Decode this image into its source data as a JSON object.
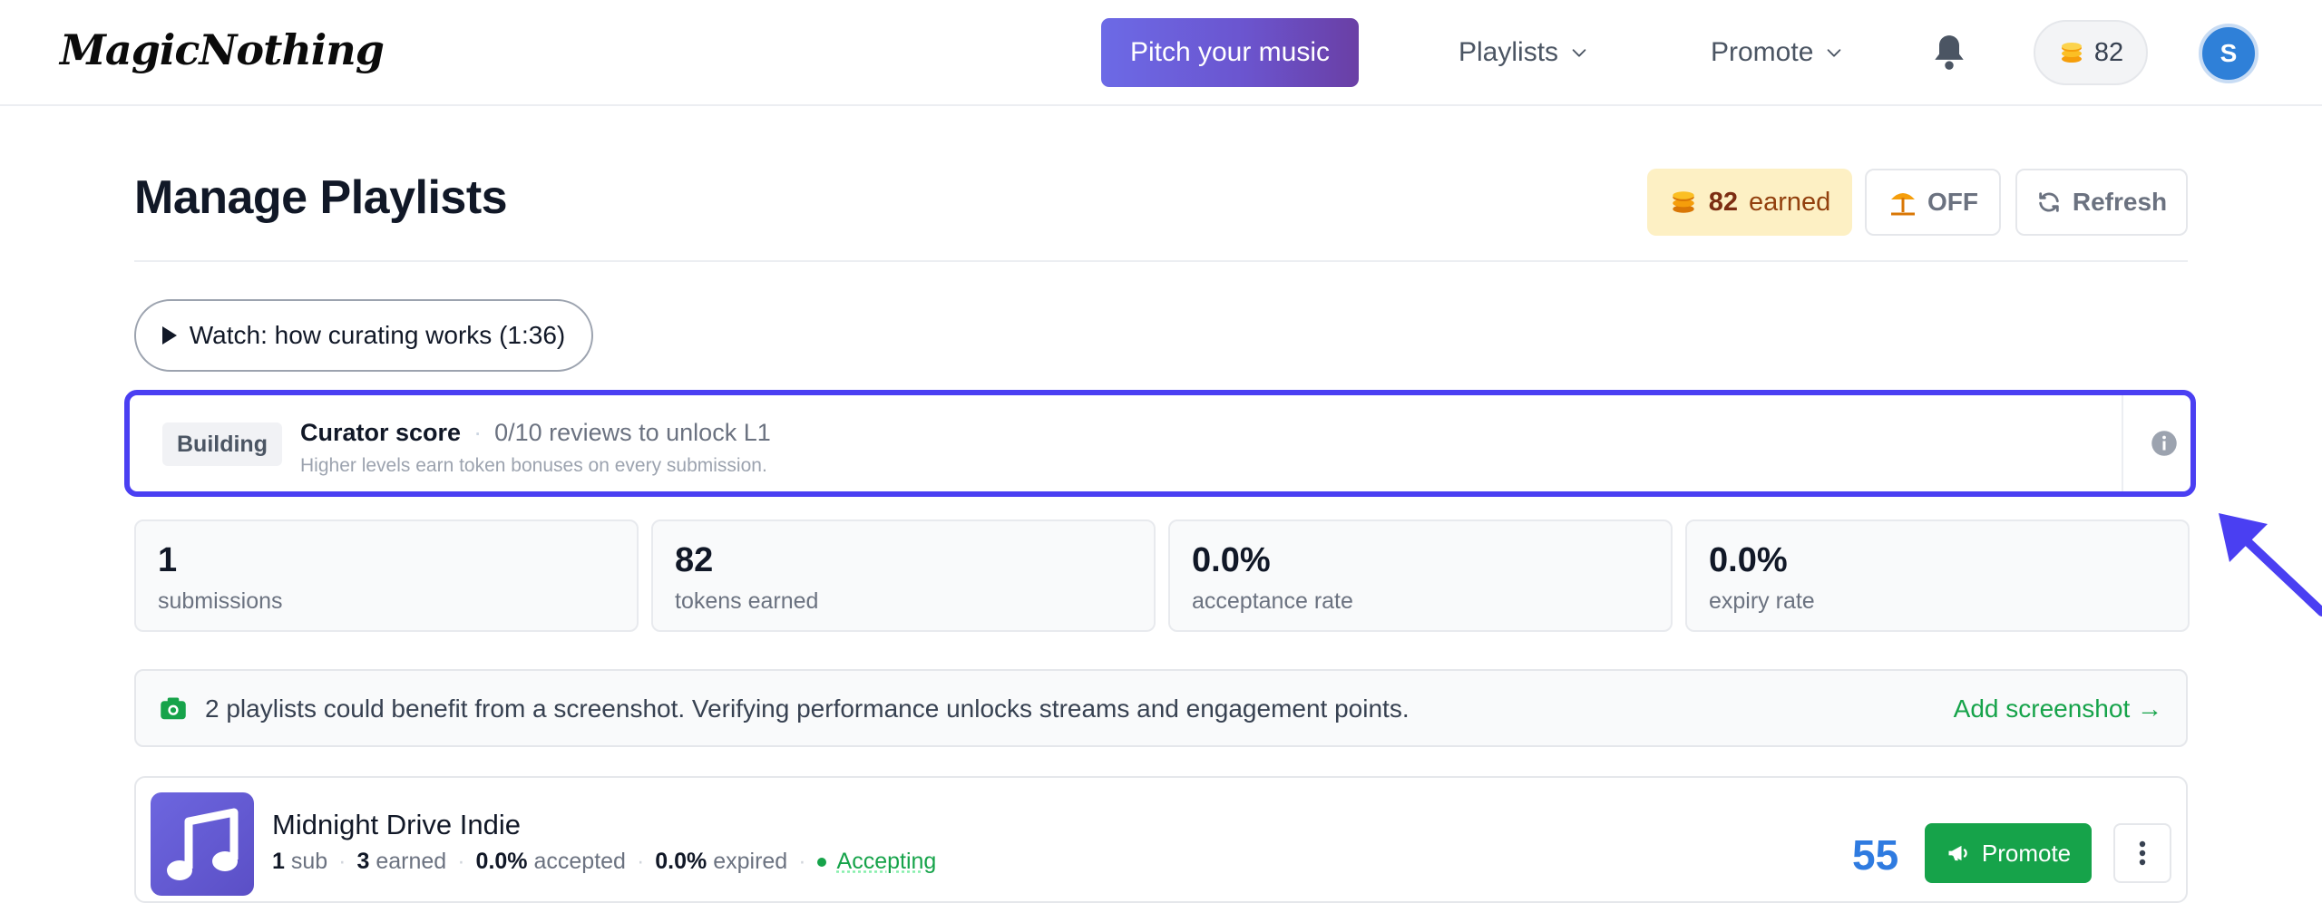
{
  "nav": {
    "logo": "MagicNothing",
    "pitch_label": "Pitch your music",
    "playlists_label": "Playlists",
    "promote_label": "Promote",
    "coin_count": "82",
    "avatar_initial": "S"
  },
  "header": {
    "title": "Manage Playlists",
    "earned_value": "82",
    "earned_label": "earned",
    "off_label": "OFF",
    "refresh_label": "Refresh"
  },
  "watch": {
    "label": "Watch: how curating works (1:36)"
  },
  "curator": {
    "badge": "Building",
    "title": "Curator score",
    "separator": "·",
    "progress": "0/10 reviews to unlock L1",
    "subtitle": "Higher levels earn token bonuses on every submission."
  },
  "stats": [
    {
      "value": "1",
      "label": "submissions"
    },
    {
      "value": "82",
      "label": "tokens earned"
    },
    {
      "value": "0.0%",
      "label": "acceptance rate"
    },
    {
      "value": "0.0%",
      "label": "expiry rate"
    }
  ],
  "notice": {
    "text": "2 playlists could benefit from a screenshot. Verifying performance unlocks streams and engagement points.",
    "link": "Add screenshot →"
  },
  "playlist": {
    "name": "Midnight Drive Indie",
    "subs_value": "1",
    "subs_label": "sub",
    "earned_value": "3",
    "earned_label": "earned",
    "accepted_value": "0.0%",
    "accepted_label": "accepted",
    "expired_value": "0.0%",
    "expired_label": "expired",
    "status": "Accepting",
    "score": "55",
    "promote_label": "Promote"
  },
  "colors": {
    "accent": "#4a3ff2",
    "green": "#16a34a",
    "score_blue": "#2f7be0",
    "earned_bg": "#fdf0c4"
  }
}
